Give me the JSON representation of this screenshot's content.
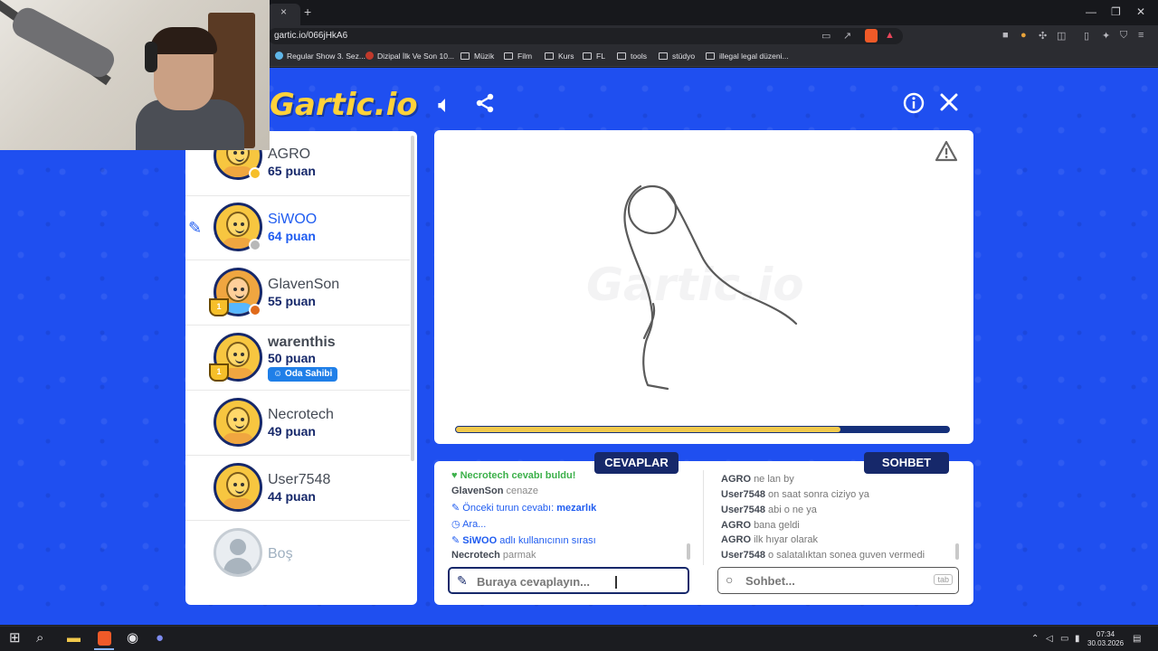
{
  "browser": {
    "url": "gartic.io/066jHkA6",
    "tab_close": "×",
    "new_tab": "+",
    "window_controls": [
      "—",
      "❐",
      "✕"
    ],
    "bookmarks": [
      {
        "label": "Regular Show 3. Sez...",
        "kind": "site"
      },
      {
        "label": "Dizipal İlk Ve Son 10...",
        "kind": "site"
      },
      {
        "label": "Müzik",
        "kind": "folder"
      },
      {
        "label": "Film",
        "kind": "folder"
      },
      {
        "label": "Kurs",
        "kind": "folder"
      },
      {
        "label": "FL",
        "kind": "folder"
      },
      {
        "label": "tools",
        "kind": "folder"
      },
      {
        "label": "stüdyo",
        "kind": "folder"
      },
      {
        "label": "illegal legal düzeni...",
        "kind": "folder"
      }
    ]
  },
  "game": {
    "logo": "Gartic.io",
    "watermark": "Gartic.io",
    "progress": 0.78,
    "colors": {
      "background": "#1f4ff0",
      "navy": "#16286a",
      "accent_blue": "#1f5cf0",
      "gold": "#f2c94c"
    },
    "players": [
      {
        "name": "AGRO",
        "points": "65 puan",
        "status_color": "#f6bf2a"
      },
      {
        "name": "SiWOO",
        "points": "64 puan",
        "drawing": true,
        "status_color": "#b8b8b8"
      },
      {
        "name": "GlavenSon",
        "points": "55 puan",
        "trophy": "1",
        "status_color": "#e06a1a"
      },
      {
        "name": "warenthis",
        "points": "50 puan",
        "trophy": "1",
        "badge": "Oda Sahibi"
      },
      {
        "name": "Necrotech",
        "points": "49 puan"
      },
      {
        "name": "User7548",
        "points": "44 puan"
      },
      {
        "name": "Boş",
        "points": "",
        "empty": true
      }
    ],
    "answers_title": "CEVAPLAR",
    "chat_title": "SOHBET",
    "answers": {
      "found_line": {
        "who": "Necrotech",
        "text": "cevabı buldu!"
      },
      "guess1": {
        "who": "GlavenSon",
        "text": "cenaze"
      },
      "prev_answer": {
        "text": "Önceki turun cevabı:",
        "value": "mezarlık"
      },
      "break": "Ara...",
      "turn": {
        "who": "SiWOO",
        "text": "adlı kullanıcının sırası"
      },
      "guess2": {
        "who": "Necrotech",
        "text": "parmak"
      }
    },
    "chat": [
      {
        "who": "AGRO",
        "text": "ne lan by"
      },
      {
        "who": "User7548",
        "text": "on saat sonra ciziyo ya"
      },
      {
        "who": "User7548",
        "text": "abi o ne ya"
      },
      {
        "who": "AGRO",
        "text": "bana geldi"
      },
      {
        "who": "AGRO",
        "text": "ilk hıyar olarak"
      },
      {
        "who": "User7548",
        "text": "o salatalıktan sonea guven vermedi"
      }
    ],
    "answer_placeholder": "Buraya cevaplayın...",
    "chat_placeholder": "Sohbet...",
    "tab_hint": "tab"
  },
  "taskbar": {
    "time": "07:34",
    "date": "30.03.2026"
  }
}
